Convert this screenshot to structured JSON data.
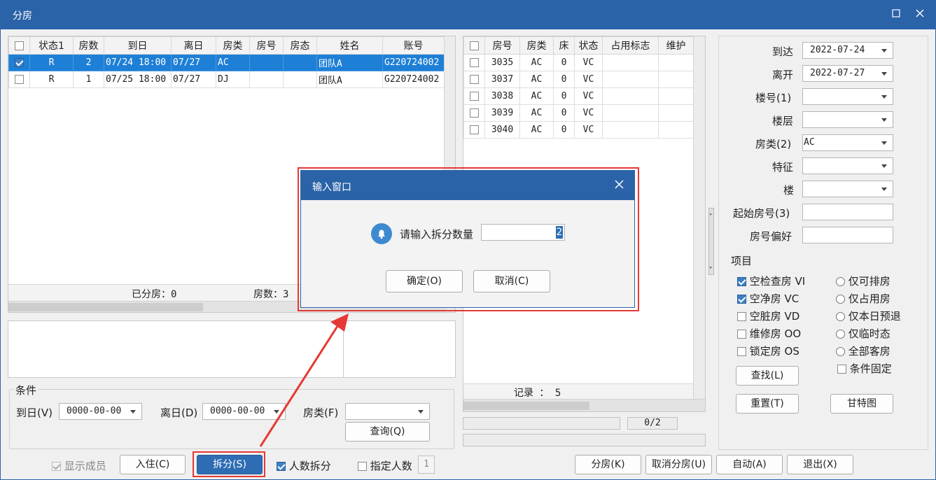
{
  "window": {
    "title": "分房",
    "maximize_icon": "maximize-icon",
    "close_icon": "close-icon"
  },
  "booking_table": {
    "headers": [
      "状态1",
      "房数",
      "到日",
      "离日",
      "房类",
      "房号",
      "房态",
      "姓名",
      "账号"
    ],
    "rows": [
      {
        "status": "R",
        "count": "2",
        "arrive": "07/24 18:00",
        "depart": "07/27",
        "type": "AC",
        "room": "",
        "state": "",
        "name": "团队A",
        "account": "G220724002",
        "checked": true,
        "selected": true
      },
      {
        "status": "R",
        "count": "1",
        "arrive": "07/25 18:00",
        "depart": "07/27",
        "type": "DJ",
        "room": "",
        "state": "",
        "name": "团队A",
        "account": "G220724002",
        "checked": false,
        "selected": false
      }
    ],
    "summary_assigned": "已分房：0",
    "summary_rooms": "房数：3"
  },
  "conditions": {
    "group_label": "条件",
    "arrive_label": "到日(V)",
    "arrive_value": "0000-00-00",
    "depart_label": "离日(D)",
    "depart_value": "0000-00-00",
    "roomtype_label": "房类(F)",
    "roomtype_value": "",
    "query_button": "查询(Q)"
  },
  "room_table": {
    "headers": [
      "房号",
      "房类",
      "床",
      "状态",
      "占用标志",
      "维护"
    ],
    "rows": [
      {
        "room": "3035",
        "type": "AC",
        "bed": "0",
        "status": "VC",
        "flag": ""
      },
      {
        "room": "3037",
        "type": "AC",
        "bed": "0",
        "status": "VC",
        "flag": ""
      },
      {
        "room": "3038",
        "type": "AC",
        "bed": "0",
        "status": "VC",
        "flag": ""
      },
      {
        "room": "3039",
        "type": "AC",
        "bed": "0",
        "status": "VC",
        "flag": ""
      },
      {
        "room": "3040",
        "type": "AC",
        "bed": "0",
        "status": "VC",
        "flag": ""
      }
    ],
    "record_label": "记录 ： 5",
    "progress_text": "0/2"
  },
  "filter": {
    "arrive_label": "到达",
    "arrive_value": "2022-07-24",
    "depart_label": "离开",
    "depart_value": "2022-07-27",
    "building_label": "楼号(1)",
    "floor_label": "楼层",
    "roomtype_label": "房类(2)",
    "roomtype_value": "AC",
    "feature_label": "特征",
    "tower_label": "楼",
    "start_room_label": "起始房号(3)",
    "pref_label": "房号偏好",
    "items_label": "项目",
    "checks": [
      {
        "label": "空检查房 VI",
        "checked": true
      },
      {
        "label": "空净房 VC",
        "checked": true
      },
      {
        "label": "空脏房 VD",
        "checked": false
      },
      {
        "label": "维修房 OO",
        "checked": false
      },
      {
        "label": "锁定房 OS",
        "checked": false
      }
    ],
    "radios": [
      "仅可排房",
      "仅占用房",
      "仅本日预退",
      "仅临时态",
      "全部客房"
    ],
    "fixed_label": "条件固定",
    "find_button": "查找(L)",
    "reset_button": "重置(T)",
    "gantt_button": "甘特图"
  },
  "bottom_bar": {
    "show_members": "显示成员",
    "checkin_button": "入住(C)",
    "split_button": "拆分(S)",
    "person_split": "人数拆分",
    "assign_count": "指定人数",
    "assign_count_value": "1",
    "assign_button": "分房(K)",
    "cancel_assign_button": "取消分房(U)",
    "auto_button": "自动(A)",
    "exit_button": "退出(X)"
  },
  "dialog": {
    "title": "输入窗口",
    "prompt": "请输入拆分数量",
    "value": "2",
    "ok_button": "确定(O)",
    "cancel_button": "取消(C)",
    "bell_icon": "bell-icon",
    "close_icon": "close-icon"
  },
  "colors": {
    "titlebar": "#2b63a8",
    "selection": "#1e7fd6",
    "annotation": "#e53935"
  }
}
